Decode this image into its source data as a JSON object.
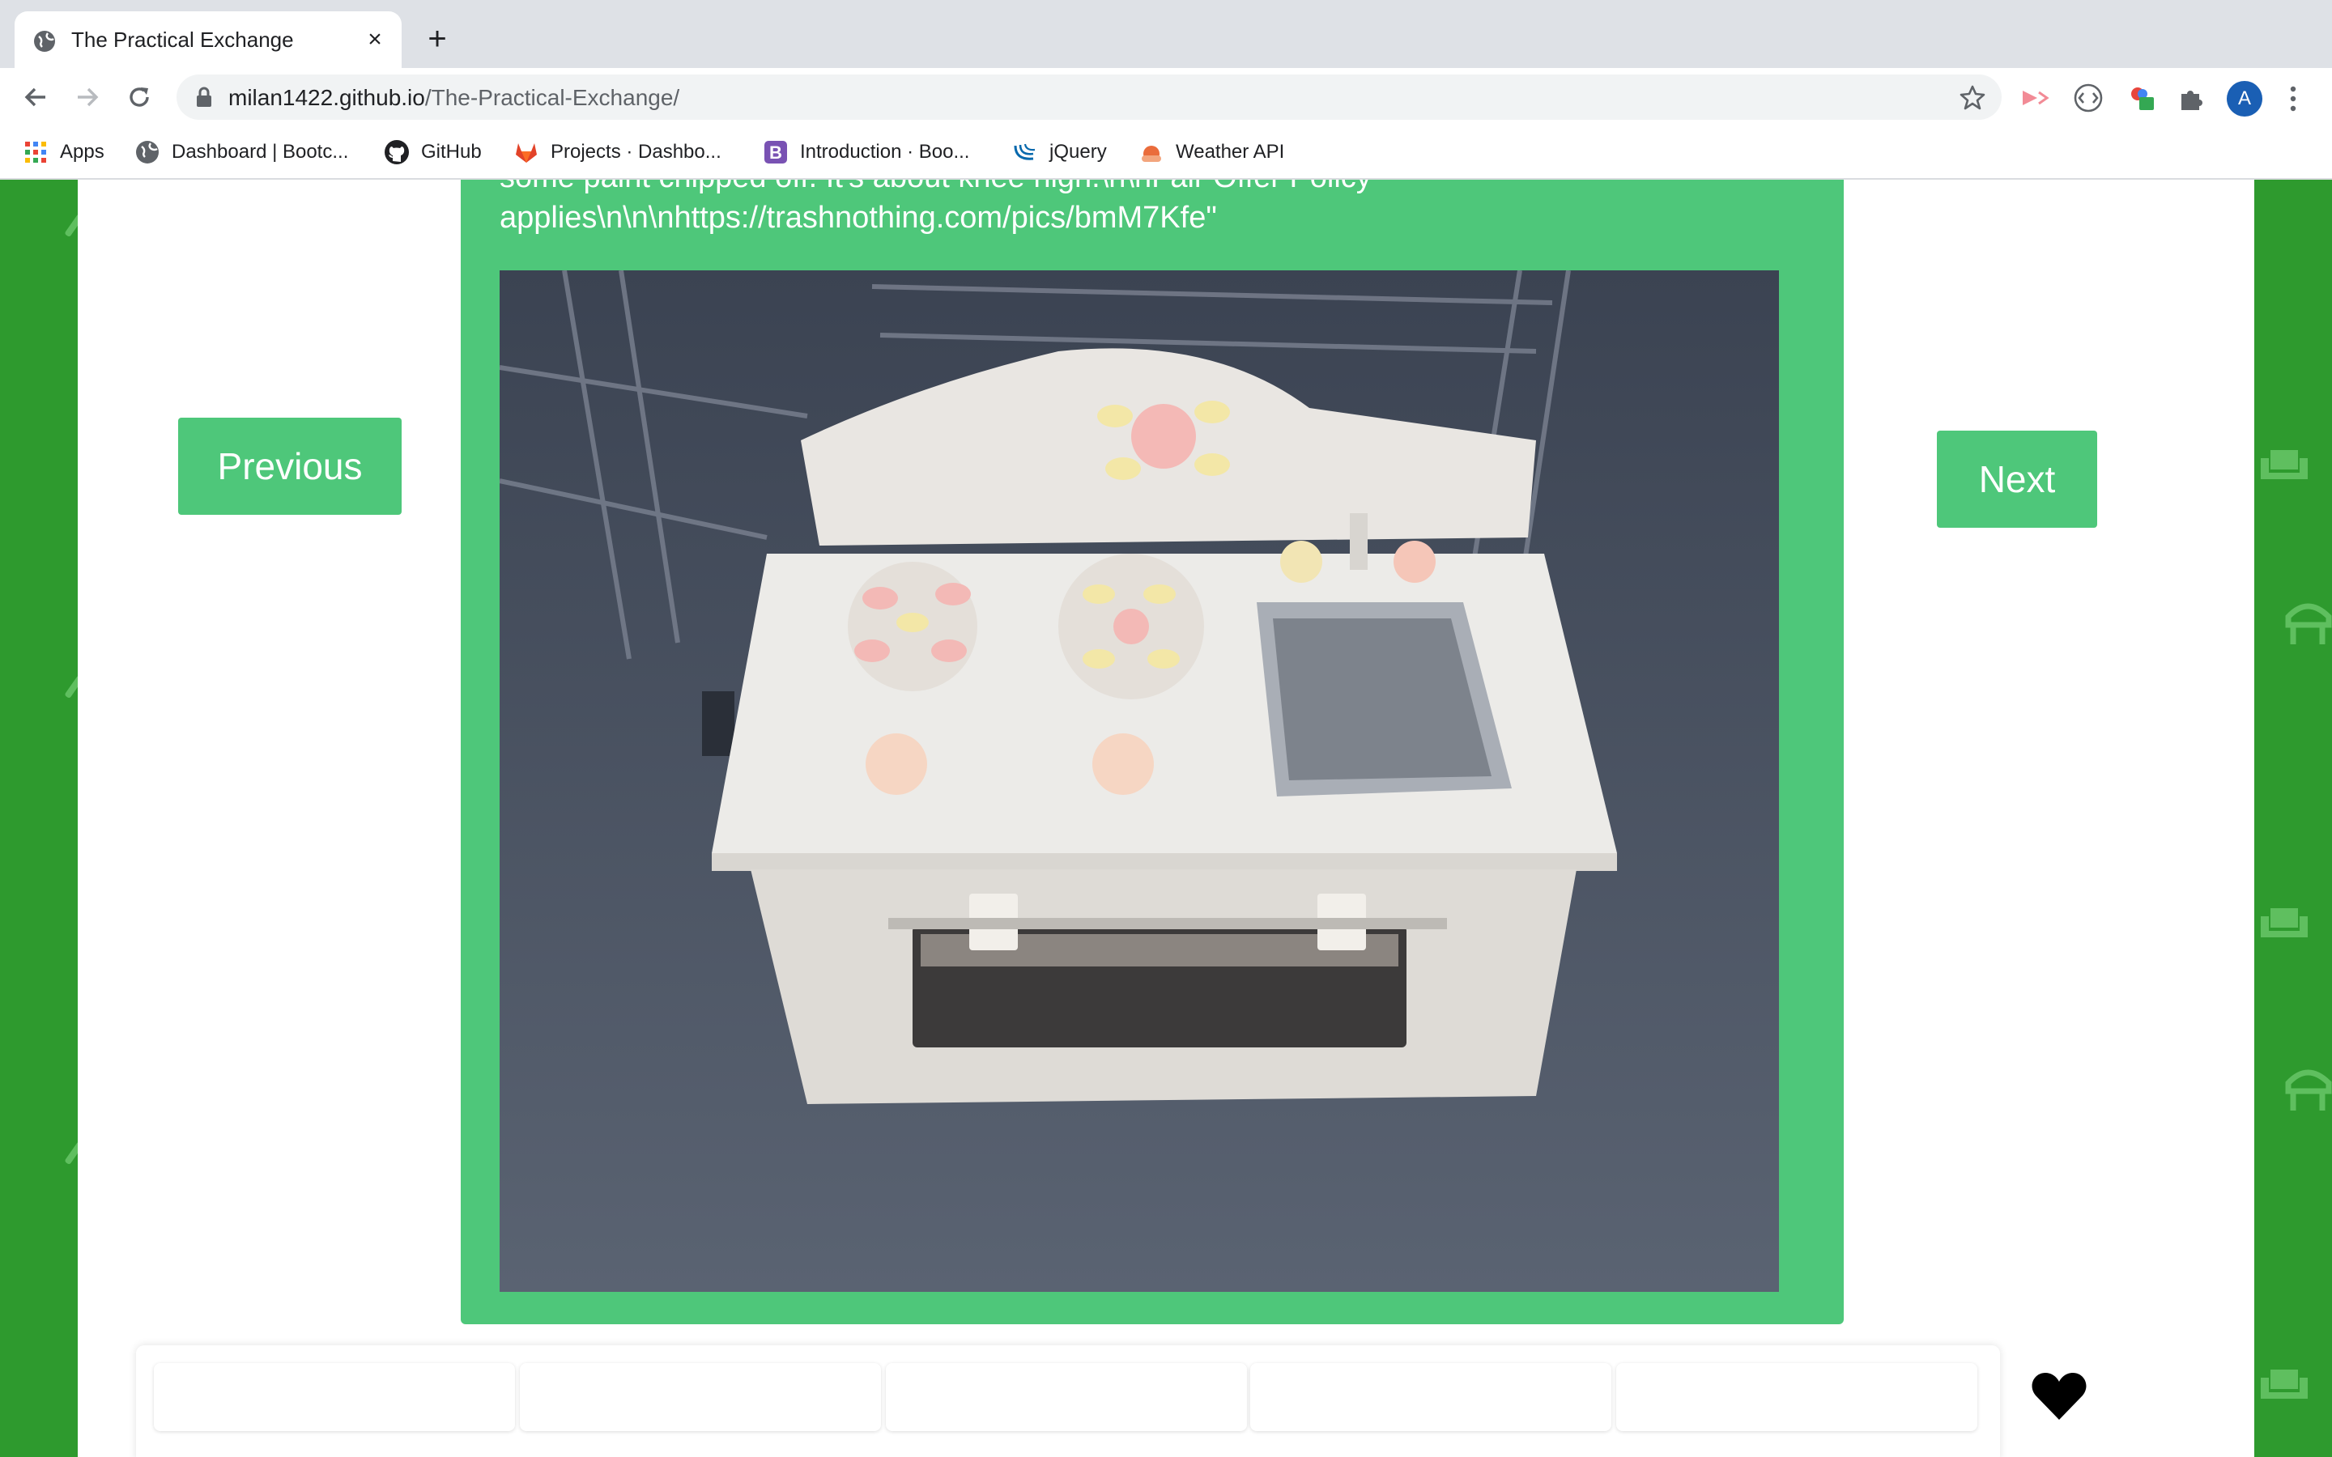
{
  "browser": {
    "tab_title": "The Practical Exchange",
    "url_host": "milan1422.github.io",
    "url_path": "/The-Practical-Exchange/",
    "profile_initial": "A",
    "bookmarks": [
      {
        "label": "Apps",
        "icon": "apps-grid-icon"
      },
      {
        "label": "Dashboard | Bootc...",
        "icon": "globe-icon"
      },
      {
        "label": "GitHub",
        "icon": "github-icon"
      },
      {
        "label": "Projects · Dashbo...",
        "icon": "gitlab-icon"
      },
      {
        "label": "Introduction · Boo...",
        "icon": "bootstrap-icon"
      },
      {
        "label": "jQuery",
        "icon": "jquery-icon"
      },
      {
        "label": "Weather API",
        "icon": "weather-icon"
      }
    ]
  },
  "listing": {
    "description_line1": "some paint chipped off. It's about knee high.\\n\\nFair Offer Policy",
    "description_line2": "applies\\n\\n\\nhttps://trashnothing.com/pics/bmM7Kfe\"",
    "photo": "toy-kitchen-photo"
  },
  "nav": {
    "previous_label": "Previous",
    "next_label": "Next"
  },
  "thumbnails_count": 5,
  "favorite_icon": "heart-icon",
  "colors": {
    "page_background": "#2e9a2e",
    "card_and_buttons": "#4ec77a",
    "tabstrip": "#dee1e6"
  }
}
